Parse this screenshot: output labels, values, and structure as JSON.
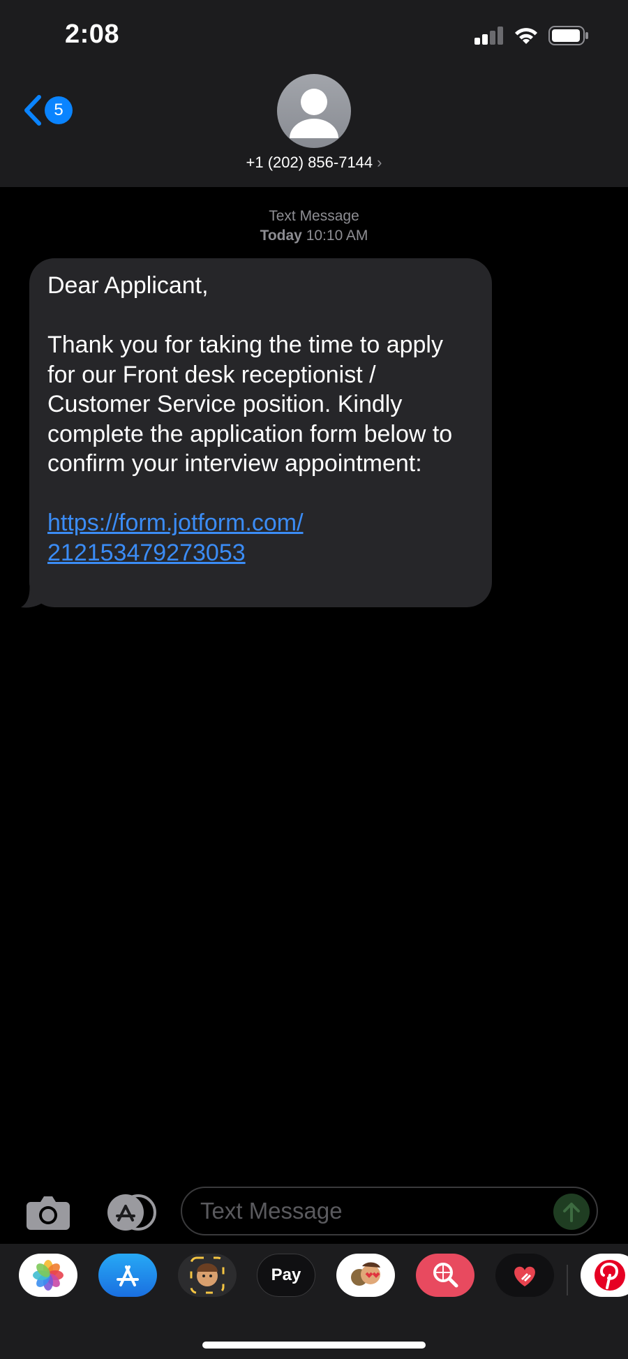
{
  "status_bar": {
    "time": "2:08"
  },
  "nav": {
    "back_count": "5",
    "contact_number": "+1 (202) 856-7144"
  },
  "thread": {
    "service": "Text Message",
    "date_bold": "Today",
    "time": "10:10 AM"
  },
  "message": {
    "greeting": "Dear Applicant,",
    "body": "Thank you for taking the time to apply for our Front desk receptionist / Customer Service position. Kindly complete the application form below to confirm your interview appointment:",
    "link_line1": "https://form.jotform.com/",
    "link_line2": "212153479273053"
  },
  "composer": {
    "placeholder": "Text Message"
  },
  "apps": [
    {
      "name": "photos-app-icon"
    },
    {
      "name": "app-store-icon"
    },
    {
      "name": "memoji-icon"
    },
    {
      "name": "apple-pay-icon",
      "label": "Pay"
    },
    {
      "name": "animoji-stickers-icon"
    },
    {
      "name": "web-search-icon"
    },
    {
      "name": "digital-touch-icon"
    },
    {
      "name": "pinterest-icon"
    }
  ],
  "colors": {
    "accent": "#0a84ff",
    "link": "#3b8cf5",
    "bubble": "#262629",
    "header": "#1c1c1e"
  }
}
